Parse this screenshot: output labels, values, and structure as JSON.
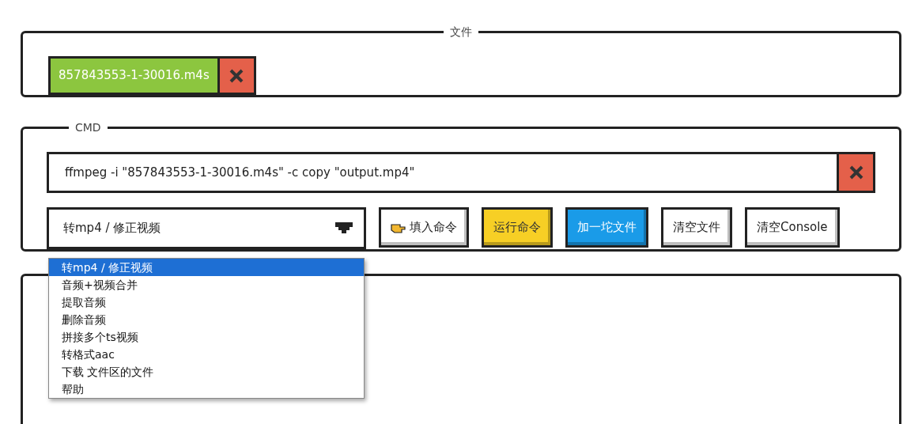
{
  "files_panel": {
    "legend": "文件",
    "files": [
      {
        "name": "857843553-1-30016.m4s"
      }
    ]
  },
  "cmd_panel": {
    "legend": "CMD",
    "command": "ffmpeg -i \"857843553-1-30016.m4s\" -c copy \"output.mp4\"",
    "preset": {
      "value": "转mp4 / 修正视频",
      "expanded": true,
      "options": [
        {
          "label": "转mp4 / 修正视频",
          "selected": true
        },
        {
          "label": "音频+视频合并",
          "selected": false
        },
        {
          "label": "提取音频",
          "selected": false
        },
        {
          "label": "删除音频",
          "selected": false
        },
        {
          "label": "拼接多个ts视频",
          "selected": false
        },
        {
          "label": "转格式aac",
          "selected": false
        },
        {
          "label": "下载 文件区的文件",
          "selected": false
        },
        {
          "label": "帮助",
          "selected": false
        }
      ]
    },
    "buttons": [
      {
        "label": "填入命令",
        "kind": "hand"
      },
      {
        "label": "运行命令",
        "kind": "yellow"
      },
      {
        "label": "加一坨文件",
        "kind": "blue"
      },
      {
        "label": "清空文件",
        "kind": "plain"
      },
      {
        "label": "清空Console",
        "kind": "plain"
      }
    ]
  }
}
